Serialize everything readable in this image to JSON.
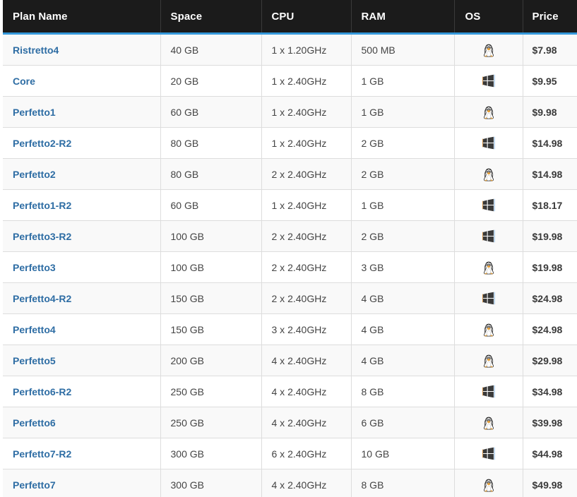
{
  "table": {
    "columns": [
      {
        "key": "plan",
        "label": "Plan Name"
      },
      {
        "key": "space",
        "label": "Space"
      },
      {
        "key": "cpu",
        "label": "CPU"
      },
      {
        "key": "ram",
        "label": "RAM"
      },
      {
        "key": "os",
        "label": "OS"
      },
      {
        "key": "price",
        "label": "Price"
      }
    ],
    "colors": {
      "header_background": "#1b1b1b",
      "header_text": "#ffffff",
      "header_accent_border": "#3498db",
      "row_odd_background": "#f9f9f9",
      "row_even_background": "#ffffff",
      "cell_border": "#dddddd",
      "link_text": "#2e6da4",
      "body_text": "#3a3a3a",
      "table_bottom_border": "#1b1b1b"
    },
    "icons": {
      "linux": "linux-tux-icon",
      "windows": "windows-logo-icon"
    },
    "rows": [
      {
        "plan": "Ristretto4",
        "space": "40 GB",
        "cpu": "1 x 1.20GHz",
        "ram": "500 MB",
        "os": "linux",
        "price": "$7.98"
      },
      {
        "plan": "Core",
        "space": "20 GB",
        "cpu": "1 x 2.40GHz",
        "ram": "1 GB",
        "os": "windows",
        "price": "$9.95"
      },
      {
        "plan": "Perfetto1",
        "space": "60 GB",
        "cpu": "1 x 2.40GHz",
        "ram": "1 GB",
        "os": "linux",
        "price": "$9.98"
      },
      {
        "plan": "Perfetto2-R2",
        "space": "80 GB",
        "cpu": "1 x 2.40GHz",
        "ram": "2 GB",
        "os": "windows",
        "price": "$14.98"
      },
      {
        "plan": "Perfetto2",
        "space": "80 GB",
        "cpu": "2 x 2.40GHz",
        "ram": "2 GB",
        "os": "linux",
        "price": "$14.98"
      },
      {
        "plan": "Perfetto1-R2",
        "space": "60 GB",
        "cpu": "1 x 2.40GHz",
        "ram": "1 GB",
        "os": "windows",
        "price": "$18.17"
      },
      {
        "plan": "Perfetto3-R2",
        "space": "100 GB",
        "cpu": "2 x 2.40GHz",
        "ram": "2 GB",
        "os": "windows",
        "price": "$19.98"
      },
      {
        "plan": "Perfetto3",
        "space": "100 GB",
        "cpu": "2 x 2.40GHz",
        "ram": "3 GB",
        "os": "linux",
        "price": "$19.98"
      },
      {
        "plan": "Perfetto4-R2",
        "space": "150 GB",
        "cpu": "2 x 2.40GHz",
        "ram": "4 GB",
        "os": "windows",
        "price": "$24.98"
      },
      {
        "plan": "Perfetto4",
        "space": "150 GB",
        "cpu": "3 x 2.40GHz",
        "ram": "4 GB",
        "os": "linux",
        "price": "$24.98"
      },
      {
        "plan": "Perfetto5",
        "space": "200 GB",
        "cpu": "4 x 2.40GHz",
        "ram": "4 GB",
        "os": "linux",
        "price": "$29.98"
      },
      {
        "plan": "Perfetto6-R2",
        "space": "250 GB",
        "cpu": "4 x 2.40GHz",
        "ram": "8 GB",
        "os": "windows",
        "price": "$34.98"
      },
      {
        "plan": "Perfetto6",
        "space": "250 GB",
        "cpu": "4 x 2.40GHz",
        "ram": "6 GB",
        "os": "linux",
        "price": "$39.98"
      },
      {
        "plan": "Perfetto7-R2",
        "space": "300 GB",
        "cpu": "6 x 2.40GHz",
        "ram": "10 GB",
        "os": "windows",
        "price": "$44.98"
      },
      {
        "plan": "Perfetto7",
        "space": "300 GB",
        "cpu": "4 x 2.40GHz",
        "ram": "8 GB",
        "os": "linux",
        "price": "$49.98"
      }
    ]
  }
}
